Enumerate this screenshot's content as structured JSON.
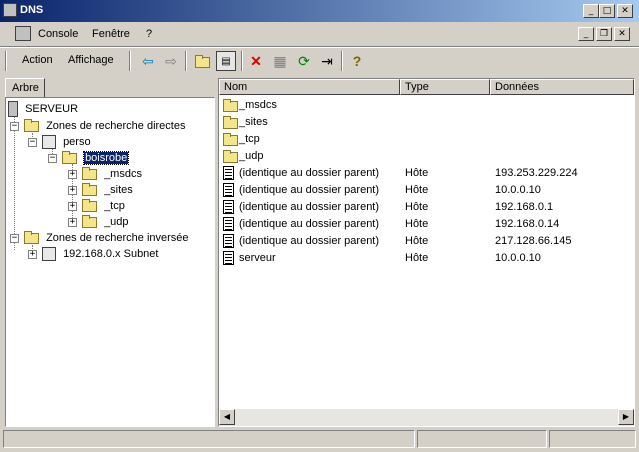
{
  "window": {
    "title": "DNS"
  },
  "menubar1": {
    "console": "Console",
    "fenetre": "Fenêtre",
    "help": "?"
  },
  "menubar2": {
    "action": "Action",
    "affichage": "Affichage"
  },
  "tree": {
    "tab_label": "Arbre",
    "items": [
      {
        "label": "SERVEUR"
      },
      {
        "label": "Zones de recherche directes"
      },
      {
        "label": "perso"
      },
      {
        "label": "boisrobe"
      },
      {
        "label": "_msdcs"
      },
      {
        "label": "_sites"
      },
      {
        "label": "_tcp"
      },
      {
        "label": "_udp"
      },
      {
        "label": "Zones de recherche inversée"
      },
      {
        "label": "192.168.0.x Subnet"
      }
    ]
  },
  "list": {
    "columns": [
      "Nom",
      "Type",
      "Données"
    ],
    "rows": [
      {
        "nom": "_msdcs",
        "type": "",
        "donnees": "",
        "icon": "folder-icon"
      },
      {
        "nom": "_sites",
        "type": "",
        "donnees": "",
        "icon": "folder-icon"
      },
      {
        "nom": "_tcp",
        "type": "",
        "donnees": "",
        "icon": "folder-icon"
      },
      {
        "nom": "_udp",
        "type": "",
        "donnees": "",
        "icon": "folder-icon"
      },
      {
        "nom": "(identique au dossier parent)",
        "type": "Hôte",
        "donnees": "193.253.229.224",
        "icon": "record-icon"
      },
      {
        "nom": "(identique au dossier parent)",
        "type": "Hôte",
        "donnees": "10.0.0.10",
        "icon": "record-icon"
      },
      {
        "nom": "(identique au dossier parent)",
        "type": "Hôte",
        "donnees": "192.168.0.1",
        "icon": "record-icon"
      },
      {
        "nom": "(identique au dossier parent)",
        "type": "Hôte",
        "donnees": "192.168.0.14",
        "icon": "record-icon"
      },
      {
        "nom": "(identique au dossier parent)",
        "type": "Hôte",
        "donnees": "217.128.66.145",
        "icon": "record-icon"
      },
      {
        "nom": "serveur",
        "type": "Hôte",
        "donnees": "10.0.0.10",
        "icon": "record-icon"
      }
    ]
  },
  "colors": {
    "titlebar_start": "#0a246a",
    "titlebar_end": "#a6caf0",
    "face": "#d4d0c8",
    "selection": "#0a246a"
  }
}
